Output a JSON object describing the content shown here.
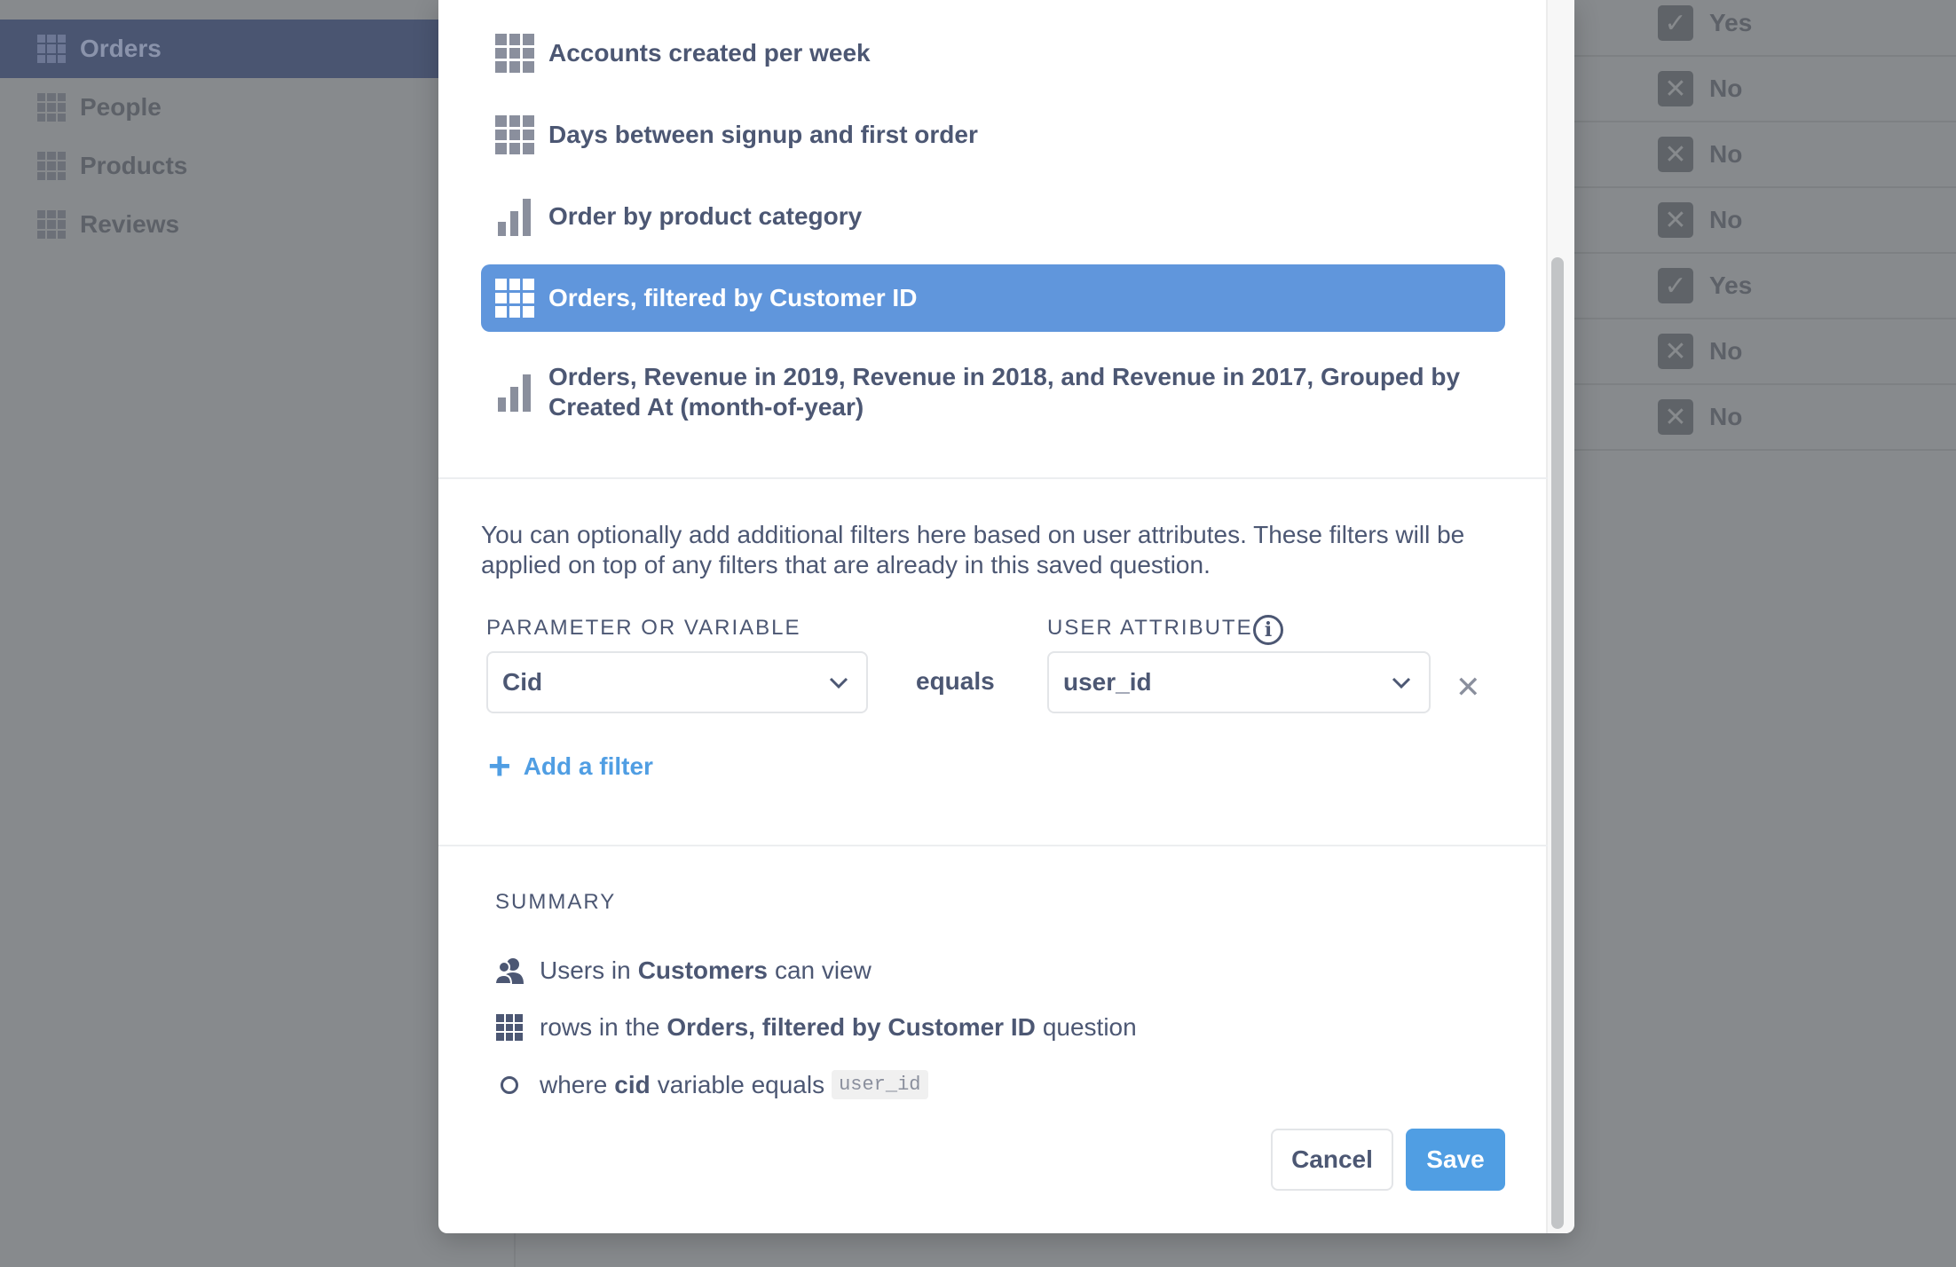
{
  "sidebar": {
    "items": [
      {
        "label": "Orders",
        "active": true
      },
      {
        "label": "People"
      },
      {
        "label": "Products"
      },
      {
        "label": "Reviews"
      }
    ]
  },
  "background_rows": [
    {
      "check": "yes",
      "label": "Yes"
    },
    {
      "check": "no",
      "label": "No"
    },
    {
      "check": "no",
      "label": "No"
    },
    {
      "check": "no",
      "label": "No"
    },
    {
      "check": "yes",
      "label": "Yes"
    },
    {
      "check": "no",
      "label": "No"
    },
    {
      "check": "no",
      "label": "No"
    }
  ],
  "questions": [
    {
      "label": "Accounts created per week",
      "icon": "table-icon"
    },
    {
      "label": "Days between signup and first order",
      "icon": "table-icon"
    },
    {
      "label": "Order by product category",
      "icon": "bar-chart-icon"
    },
    {
      "label": "Orders, filtered by Customer ID",
      "icon": "table-icon",
      "selected": true
    },
    {
      "label_line1": "Orders, Revenue in 2019, Revenue in 2018, and Revenue in 2017, Grouped by",
      "label_line2": "Created At (month-of-year)",
      "icon": "bar-chart-icon"
    }
  ],
  "filters": {
    "description": "You can optionally add additional filters here based on user attributes. These filters will be applied on top of any filters that are already in this saved question.",
    "param_label": "PARAMETER OR VARIABLE",
    "attr_label": "USER ATTRIBUTE",
    "param_value": "Cid",
    "operator": "equals",
    "attr_value": "user_id",
    "add_filter": "Add a filter"
  },
  "summary": {
    "label": "SUMMARY",
    "row1": {
      "pre": "Users in",
      "bold": "Customers",
      "post": "can view"
    },
    "row2": {
      "pre": "rows in the",
      "bold": "Orders, filtered by Customer ID",
      "post": "question"
    },
    "row3": {
      "pre": "where",
      "bold": "cid",
      "post": "variable equals",
      "code": "user_id"
    }
  },
  "buttons": {
    "cancel": "Cancel",
    "save": "Save"
  },
  "colors": {
    "accent": "#509ee3",
    "selected_bg": "#6096dc",
    "text": "#4c5773"
  }
}
